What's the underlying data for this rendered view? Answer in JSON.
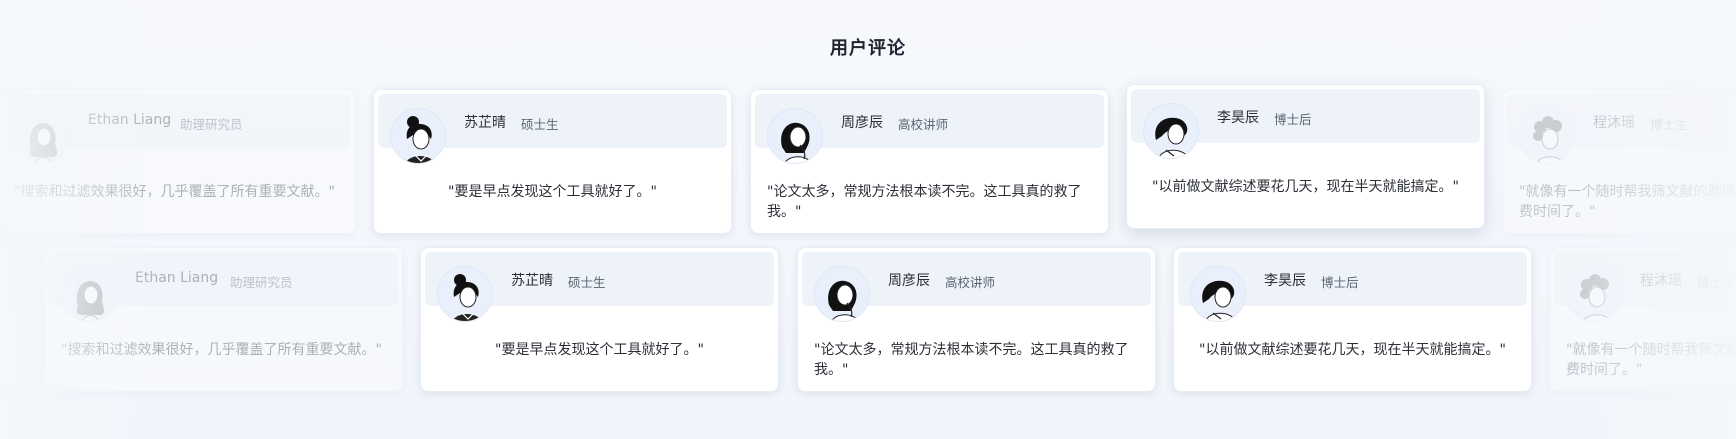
{
  "section": {
    "title": "用户评论"
  },
  "reviewers": {
    "ethan": {
      "name": "Ethan Liang",
      "role": "助理研究员",
      "quote": "\"搜索和过滤效果很好，几乎覆盖了所有重要文献。\"",
      "avatar": "woman-long-hair-avatar"
    },
    "su": {
      "name": "苏芷晴",
      "role": "硕士生",
      "quote": "\"要是早点发现这个工具就好了。\"",
      "avatar": "woman-bun-avatar"
    },
    "zhou": {
      "name": "周彦辰",
      "role": "高校讲师",
      "quote": "\"论文太多，常规方法根本读不完。这工具真的救了我。\"",
      "avatar": "woman-hand-on-chin-avatar"
    },
    "li": {
      "name": "李昊辰",
      "role": "博士后",
      "quote": "\"以前做文献综述要花几天，现在半天就能搞定。\"",
      "avatar": "woman-short-hair-avatar"
    },
    "cheng": {
      "name": "程沐瑶",
      "role": "博士生",
      "quote": "\"就像有一个随时帮我筛文献的助理，节省了我好多费时间了。\"",
      "avatar": "curly-hair-avatar"
    }
  },
  "colors": {
    "card_bg": "#ffffff",
    "card_head": "#eef3f9",
    "page_bg": "#f4f7fb"
  }
}
